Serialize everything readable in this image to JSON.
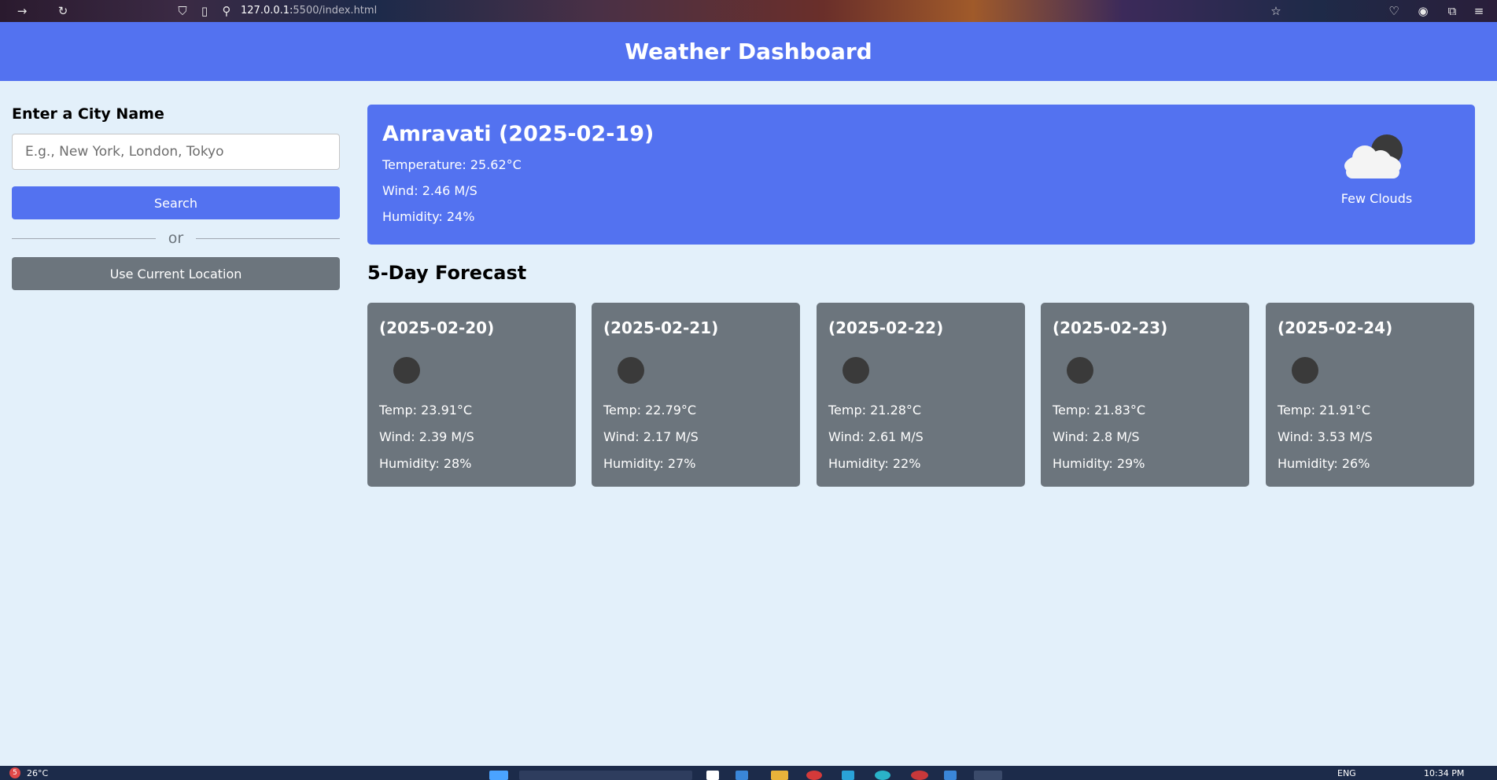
{
  "browser": {
    "url_host": "127.0.0.1:",
    "url_path": "5500/index.html"
  },
  "header": {
    "title": "Weather Dashboard"
  },
  "sidebar": {
    "heading": "Enter a City Name",
    "input_placeholder": "E.g., New York, London, Tokyo",
    "input_value": "",
    "search_label": "Search",
    "separator_text": "or",
    "location_label": "Use Current Location"
  },
  "current": {
    "title": "Amravati (2025-02-19)",
    "temperature": "Temperature: 25.62°C",
    "wind": "Wind: 2.46 M/S",
    "humidity": "Humidity: 24%",
    "icon": "few-clouds-night-icon",
    "description": "Few Clouds"
  },
  "forecast": {
    "title": "5-Day Forecast",
    "days": [
      {
        "date": "(2025-02-20)",
        "temp": "Temp: 23.91°C",
        "wind": "Wind: 2.39 M/S",
        "humidity": "Humidity: 28%",
        "icon": "moon-icon"
      },
      {
        "date": "(2025-02-21)",
        "temp": "Temp: 22.79°C",
        "wind": "Wind: 2.17 M/S",
        "humidity": "Humidity: 27%",
        "icon": "moon-icon"
      },
      {
        "date": "(2025-02-22)",
        "temp": "Temp: 21.28°C",
        "wind": "Wind: 2.61 M/S",
        "humidity": "Humidity: 22%",
        "icon": "moon-icon"
      },
      {
        "date": "(2025-02-23)",
        "temp": "Temp: 21.83°C",
        "wind": "Wind: 2.8 M/S",
        "humidity": "Humidity: 29%",
        "icon": "moon-icon"
      },
      {
        "date": "(2025-02-24)",
        "temp": "Temp: 21.91°C",
        "wind": "Wind: 3.53 M/S",
        "humidity": "Humidity: 26%",
        "icon": "moon-icon"
      }
    ]
  },
  "taskbar": {
    "weather_temp": "26°C",
    "notification_count": "5",
    "language": "ENG",
    "time": "10:34 PM"
  },
  "colors": {
    "primary": "#5372f0",
    "secondary": "#6c757d",
    "background": "#e3f0fa"
  }
}
